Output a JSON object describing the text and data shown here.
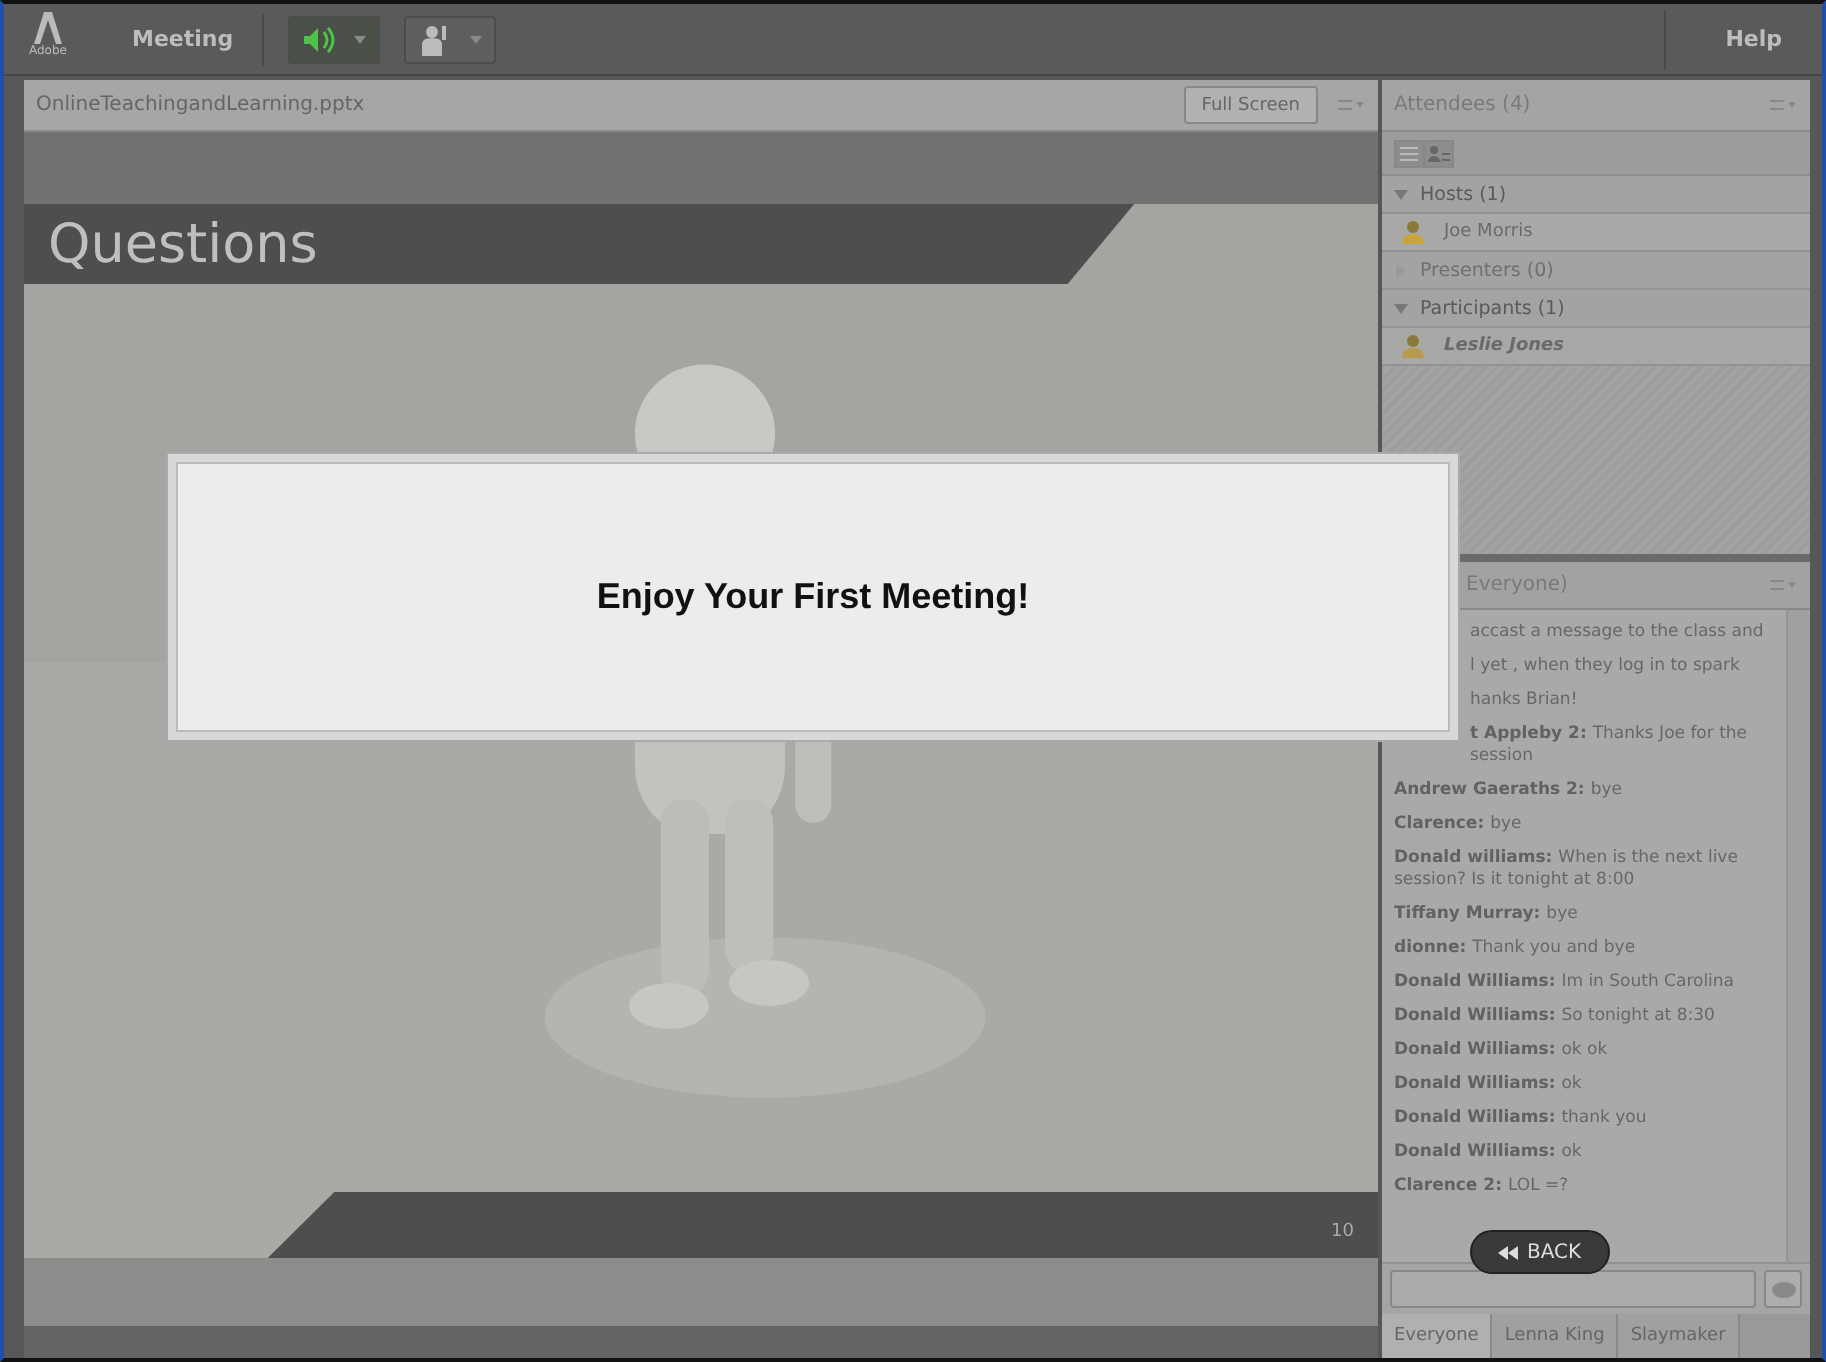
{
  "menu_bar": {
    "logo": "Adobe",
    "menu": "Meeting",
    "buttons": [
      {
        "kind": "speaker",
        "on": true
      },
      {
        "kind": "hand",
        "on": false
      }
    ],
    "help": "Help"
  },
  "share_pod": {
    "title": "OnlineTeachingandLearning.pptx",
    "full_screen": "Full Screen",
    "slide": {
      "title": "Questions",
      "number": "10"
    }
  },
  "dialog": {
    "message": "Enjoy Your First Meeting!"
  },
  "attendees": {
    "title": "Attendees (4)",
    "groups": [
      {
        "label": "Hosts (1)",
        "expanded": true,
        "members": [
          {
            "name": "Joe Morris",
            "kind": "host"
          }
        ]
      },
      {
        "label": "Presenters (0)",
        "expanded": false
      },
      {
        "label": "Participants (1)",
        "expanded": true,
        "members": [
          {
            "name": "Leslie Jones",
            "kind": "participant"
          }
        ]
      }
    ]
  },
  "chat": {
    "title": "Everyone)",
    "messages": [
      {
        "kind": "partial",
        "text": "accast a message to the class and"
      },
      {
        "kind": "partial",
        "text": "l yet , when they log in to spark"
      },
      {
        "kind": "partial",
        "text": "hanks Brian!"
      },
      {
        "kind": "partial",
        "name": "t Appleby 2:",
        "text": "Thanks Joe for the session"
      },
      {
        "kind": "full",
        "name": "Andrew Gaeraths 2:",
        "text": "bye"
      },
      {
        "kind": "full",
        "name": "Clarence:",
        "text": "bye"
      },
      {
        "kind": "full",
        "name": "Donald williams:",
        "text": "When is the next live session? Is it tonight at 8:00"
      },
      {
        "kind": "full",
        "name": "Tiffany Murray:",
        "text": "bye"
      },
      {
        "kind": "full",
        "name": "dionne:",
        "text": "Thank you and bye"
      },
      {
        "kind": "full",
        "name": "Donald Williams:",
        "text": "Im in South Carolina"
      },
      {
        "kind": "full",
        "name": "Donald Williams:",
        "text": "So tonight at 8:30"
      },
      {
        "kind": "full",
        "name": "Donald Williams:",
        "text": "ok ok"
      },
      {
        "kind": "full",
        "name": "Donald Williams:",
        "text": "ok"
      },
      {
        "kind": "full",
        "name": "Donald Williams:",
        "text": "thank you"
      },
      {
        "kind": "full",
        "name": "Donald Williams:",
        "text": "ok"
      },
      {
        "kind": "full",
        "name": "Clarence 2:",
        "text": "LOL =?"
      }
    ],
    "back": "BACK",
    "tabs": [
      {
        "label": "Everyone",
        "selected": true
      },
      {
        "label": "Lenna King",
        "selected": false
      },
      {
        "label": "Slaymaker",
        "selected": false
      }
    ]
  }
}
